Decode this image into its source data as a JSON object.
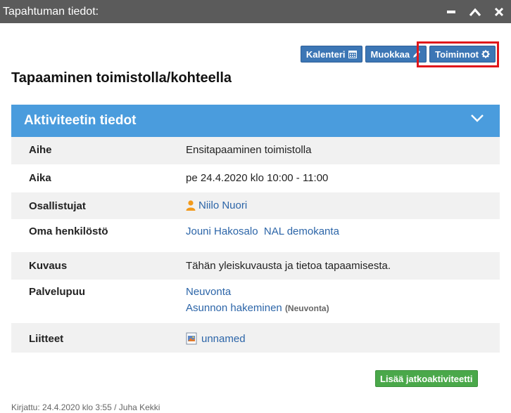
{
  "window": {
    "title": "Tapahtuman tiedot:"
  },
  "toolbar": {
    "calendar_label": "Kalenteri",
    "edit_label": "Muokkaa",
    "actions_label": "Toiminnot"
  },
  "page": {
    "title": "Tapaaminen toimistolla/kohteella"
  },
  "panel": {
    "title": "Aktiviteetin tiedot",
    "rows": {
      "subject": {
        "label": "Aihe",
        "value": "Ensitapaaminen toimistolla"
      },
      "time": {
        "label": "Aika",
        "value": "pe 24.4.2020 klo 10:00 - 11:00"
      },
      "participants": {
        "label": "Osallistujat",
        "value": "Niilo Nuori"
      },
      "staff": {
        "label": "Oma henkilöstö",
        "value_1": "Jouni Hakosalo",
        "value_2": "NAL demokanta"
      },
      "description": {
        "label": "Kuvaus",
        "value": "Tähän yleiskuvausta ja tietoa tapaamisesta."
      },
      "service_tree": {
        "label": "Palvelupuu",
        "value_1": "Neuvonta",
        "value_2": "Asunnon hakeminen",
        "value_2_note": "(Neuvonta)"
      },
      "attachments": {
        "label": "Liitteet",
        "value": "unnamed"
      }
    }
  },
  "actions": {
    "add_followup_label": "Lisää jatkoaktiviteetti"
  },
  "footer": {
    "text": "Kirjattu: 24.4.2020 klo 3:55 / Juha Kekki"
  },
  "colors": {
    "titlebar": "#5b5b5b",
    "button_blue": "#3c76b5",
    "panel_header": "#4a9cdd",
    "highlight": "#e0161b",
    "link": "#2c65a8",
    "green_button": "#4aa84a",
    "person_icon": "#f29a1c"
  }
}
